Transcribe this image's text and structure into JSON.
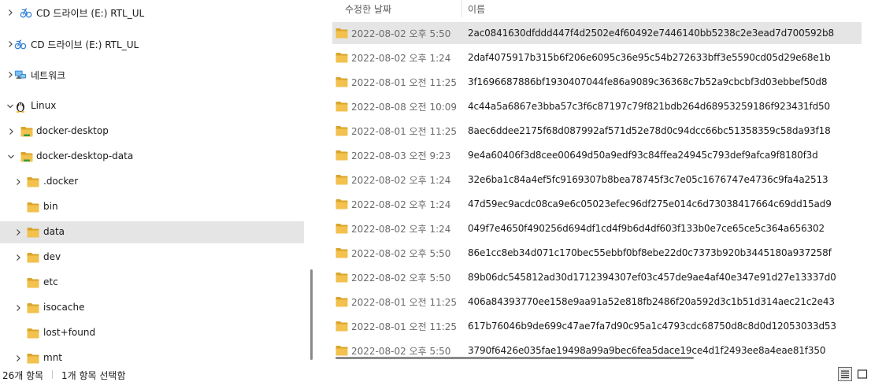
{
  "colors": {
    "selection": "#e5e5e5",
    "folder": "#f2c14e",
    "folder_dark": "#d9a52b",
    "muted_text": "#6b6b6b"
  },
  "nav": {
    "items": [
      {
        "label": "CD 드라이브 (E:) RTL_UL",
        "icon": "cd-drive-icon",
        "chevron": "right"
      },
      {
        "label": "CD 드라이브 (E:) RTL_UL",
        "icon": "cd-drive-icon",
        "chevron": "right"
      },
      {
        "label": "네트워크",
        "icon": "network-icon",
        "chevron": "right"
      },
      {
        "label": "Linux",
        "icon": "linux-penguin-icon",
        "chevron": "down"
      },
      {
        "label": "docker-desktop",
        "icon": "linux-folder-icon",
        "chevron": "right"
      },
      {
        "label": "docker-desktop-data",
        "icon": "linux-folder-icon",
        "chevron": "down"
      },
      {
        "label": ".docker",
        "icon": "folder-icon",
        "chevron": "right"
      },
      {
        "label": "bin",
        "icon": "folder-icon",
        "chevron": "none"
      },
      {
        "label": "data",
        "icon": "folder-icon",
        "chevron": "right",
        "selected": true
      },
      {
        "label": "dev",
        "icon": "folder-icon",
        "chevron": "right"
      },
      {
        "label": "etc",
        "icon": "folder-icon",
        "chevron": "none"
      },
      {
        "label": "isocache",
        "icon": "folder-icon",
        "chevron": "right"
      },
      {
        "label": "lost+found",
        "icon": "folder-icon",
        "chevron": "none"
      },
      {
        "label": "mnt",
        "icon": "folder-icon",
        "chevron": "right"
      }
    ]
  },
  "content": {
    "columns": {
      "date": "수정한 날짜",
      "name": "이름"
    },
    "rows": [
      {
        "date": "2022-08-02 오후 5:50",
        "name": "2ac0841630dfddd447f4d2502e4f60492e7446140bb5238c2e3ead7d700592b8",
        "selected": true
      },
      {
        "date": "2022-08-02 오후 1:24",
        "name": "2daf4075917b315b6f206e6095c36e95c54b272633bff3e5590cd05d29e68e1b"
      },
      {
        "date": "2022-08-01 오전 11:25",
        "name": "3f1696687886bf1930407044fe86a9089c36368c7b52a9cbcbf3d03ebbef50d8"
      },
      {
        "date": "2022-08-08 오전 10:09",
        "name": "4c44a5a6867e3bba57c3f6c87197c79f821bdb264d68953259186f923431fd50"
      },
      {
        "date": "2022-08-01 오전 11:25",
        "name": "8aec6ddee2175f68d087992af571d52e78d0c94dcc66bc51358359c58da93f18"
      },
      {
        "date": "2022-08-03 오전 9:23",
        "name": "9e4a60406f3d8cee00649d50a9edf93c84ffea24945c793def9afca9f8180f3d"
      },
      {
        "date": "2022-08-02 오후 1:24",
        "name": "32e6ba1c84a4ef5fc9169307b8bea78745f3c7e05c1676747e4736c9fa4a2513"
      },
      {
        "date": "2022-08-02 오후 1:24",
        "name": "47d59ec9acdc08ca9e6c05023efec96df275e014c6d73038417664c69dd15ad9"
      },
      {
        "date": "2022-08-02 오후 1:24",
        "name": "049f7e4650f490256d694df1cd4f9b6d4df603f133b0e7ce65ce5c364a656302"
      },
      {
        "date": "2022-08-02 오후 5:50",
        "name": "86e1cc8eb34d071c170bec55ebbf0bf8ebe22d0c7373b920b3445180a937258f"
      },
      {
        "date": "2022-08-02 오후 5:50",
        "name": "89b06dc545812ad30d1712394307ef03c457de9ae4af40e347e91d27e13337d0"
      },
      {
        "date": "2022-08-01 오전 11:25",
        "name": "406a84393770ee158e9aa91a52e818fb2486f20a592d3c1b51d314aec21c2e43"
      },
      {
        "date": "2022-08-01 오전 11:25",
        "name": "617b76046b9de699c47ae7fa7d90c95a1c4793cdc68750d8c8d0d12053033d53"
      },
      {
        "date": "2022-08-02 오후 5:50",
        "name": "3790f6426e035fae19498a99a9bec6fea5dace19ce4d1f2493ee8a4eae81f350"
      }
    ]
  },
  "status": {
    "item_count": "26개 항목",
    "selected_count": "1개 항목 선택함"
  },
  "view": {
    "details_icon": "details-view-icon",
    "tiles_icon": "tiles-view-icon"
  }
}
